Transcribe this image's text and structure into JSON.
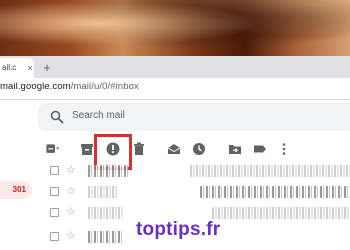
{
  "browser": {
    "tab_title": "ail.c",
    "new_tab_label": "+",
    "close_label": "×",
    "url_host": "mail.google.com",
    "url_path": "/mail/u/0/#inbox"
  },
  "gmail": {
    "search_placeholder": "Search mail",
    "inbox_count": "301",
    "toolbar_icons": [
      "select-checkbox-icon",
      "archive-icon",
      "report-spam-icon",
      "delete-icon",
      "mark-as-read-icon",
      "snooze-icon",
      "move-to-icon",
      "label-icon",
      "more-icon"
    ],
    "highlight_color": "#d9302c"
  },
  "watermark": "toptips.fr"
}
